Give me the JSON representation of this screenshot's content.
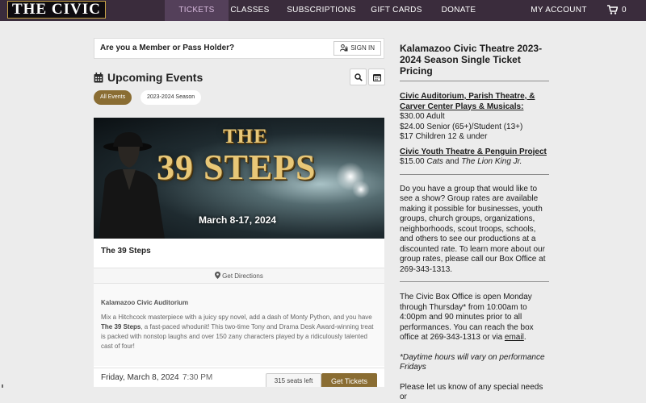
{
  "nav": {
    "logo": "THE CIVIC",
    "links": [
      "TICKETS",
      "CLASSES",
      "SUBSCRIPTIONS",
      "GIFT CARDS",
      "DONATE"
    ],
    "account": "MY ACCOUNT",
    "cart_count": "0",
    "active_color": "#54405a",
    "bar_color": "#3a2c3c"
  },
  "member": {
    "prompt": "Are you a Member or Pass Holder?",
    "sign_in": "SIGN IN"
  },
  "events": {
    "heading": "Upcoming Events",
    "filters": [
      "All Events",
      "2023-2024 Season"
    ],
    "accent_color": "#8a6d33"
  },
  "event": {
    "poster_title_line1": "THE",
    "poster_title_line2": "39 STEPS",
    "poster_dates": "March 8-17, 2024",
    "name": "The 39 Steps",
    "directions": "Get Directions",
    "venue": "Kalamazoo Civic Auditorium",
    "desc_before": "Mix a Hitchcock masterpiece with a juicy spy novel, add a dash of Monty Python, and you have ",
    "desc_bold": "The 39 Steps",
    "desc_after": ", a fast-paced whodunit! This two-time Tony and Drama Desk Award-winning treat is packed with nonstop laughs and over 150 zany characters played by a ridiculously talented cast of four!",
    "date": "Friday, March 8, 2024",
    "time": "7:30 PM",
    "seats": "315 seats left",
    "cta": "Get Tickets"
  },
  "sidebar": {
    "title": "Kalamazoo Civic Theatre 2023-2024 Season Single Ticket Pricing",
    "civic_head": "Civic Auditorium, Parish Theatre, & Carver Center Plays & Musicals:",
    "civic_prices": [
      "$30.00 Adult",
      "$24.00 Senior (65+)/Student (13+)",
      "$17 Children 12 & under"
    ],
    "youth_head": "Civic Youth Theatre & Penguin Project",
    "youth_price": "$15.00",
    "youth_show1": "Cats",
    "youth_and": "and",
    "youth_show2": "The Lion King Jr.",
    "group_text": "Do you have a group that would like to see a show? Group rates are available making it possible for businesses, youth groups, church groups, organizations, neighborhoods, scout troops, schools, and others to see our productions at a discounted rate. To learn more about our group rates, please call our Box Office at 269-343-1313.",
    "box_text": "The Civic Box Office is open Monday through Thursday* from 10:00am to 4:00pm and 90 minutes prior to all performances. You can reach the box office at 269-343-1313 or via",
    "box_link": "email",
    "note": "*Daytime hours will vary on performance Fridays",
    "last": "Please let us know of any special needs or"
  }
}
